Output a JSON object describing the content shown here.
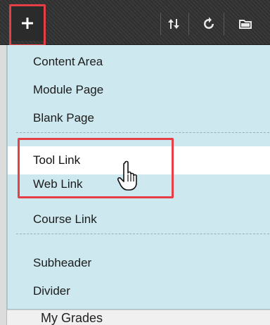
{
  "toolbar": {
    "add_icon": "plus-icon",
    "sort_icon": "sort-arrows-icon",
    "refresh_icon": "refresh-icon",
    "folder_icon": "folder-icon"
  },
  "menu": {
    "items": [
      {
        "label": "Content Area"
      },
      {
        "label": "Module Page"
      },
      {
        "label": "Blank Page"
      },
      {
        "label": "Tool Link"
      },
      {
        "label": "Web Link"
      },
      {
        "label": "Course Link"
      },
      {
        "label": "Subheader"
      },
      {
        "label": "Divider"
      }
    ]
  },
  "below": {
    "label": "My Grades"
  },
  "colors": {
    "menu_bg": "#cde8ee",
    "toolbar_bg": "#333333",
    "highlight": "#e53f45"
  }
}
